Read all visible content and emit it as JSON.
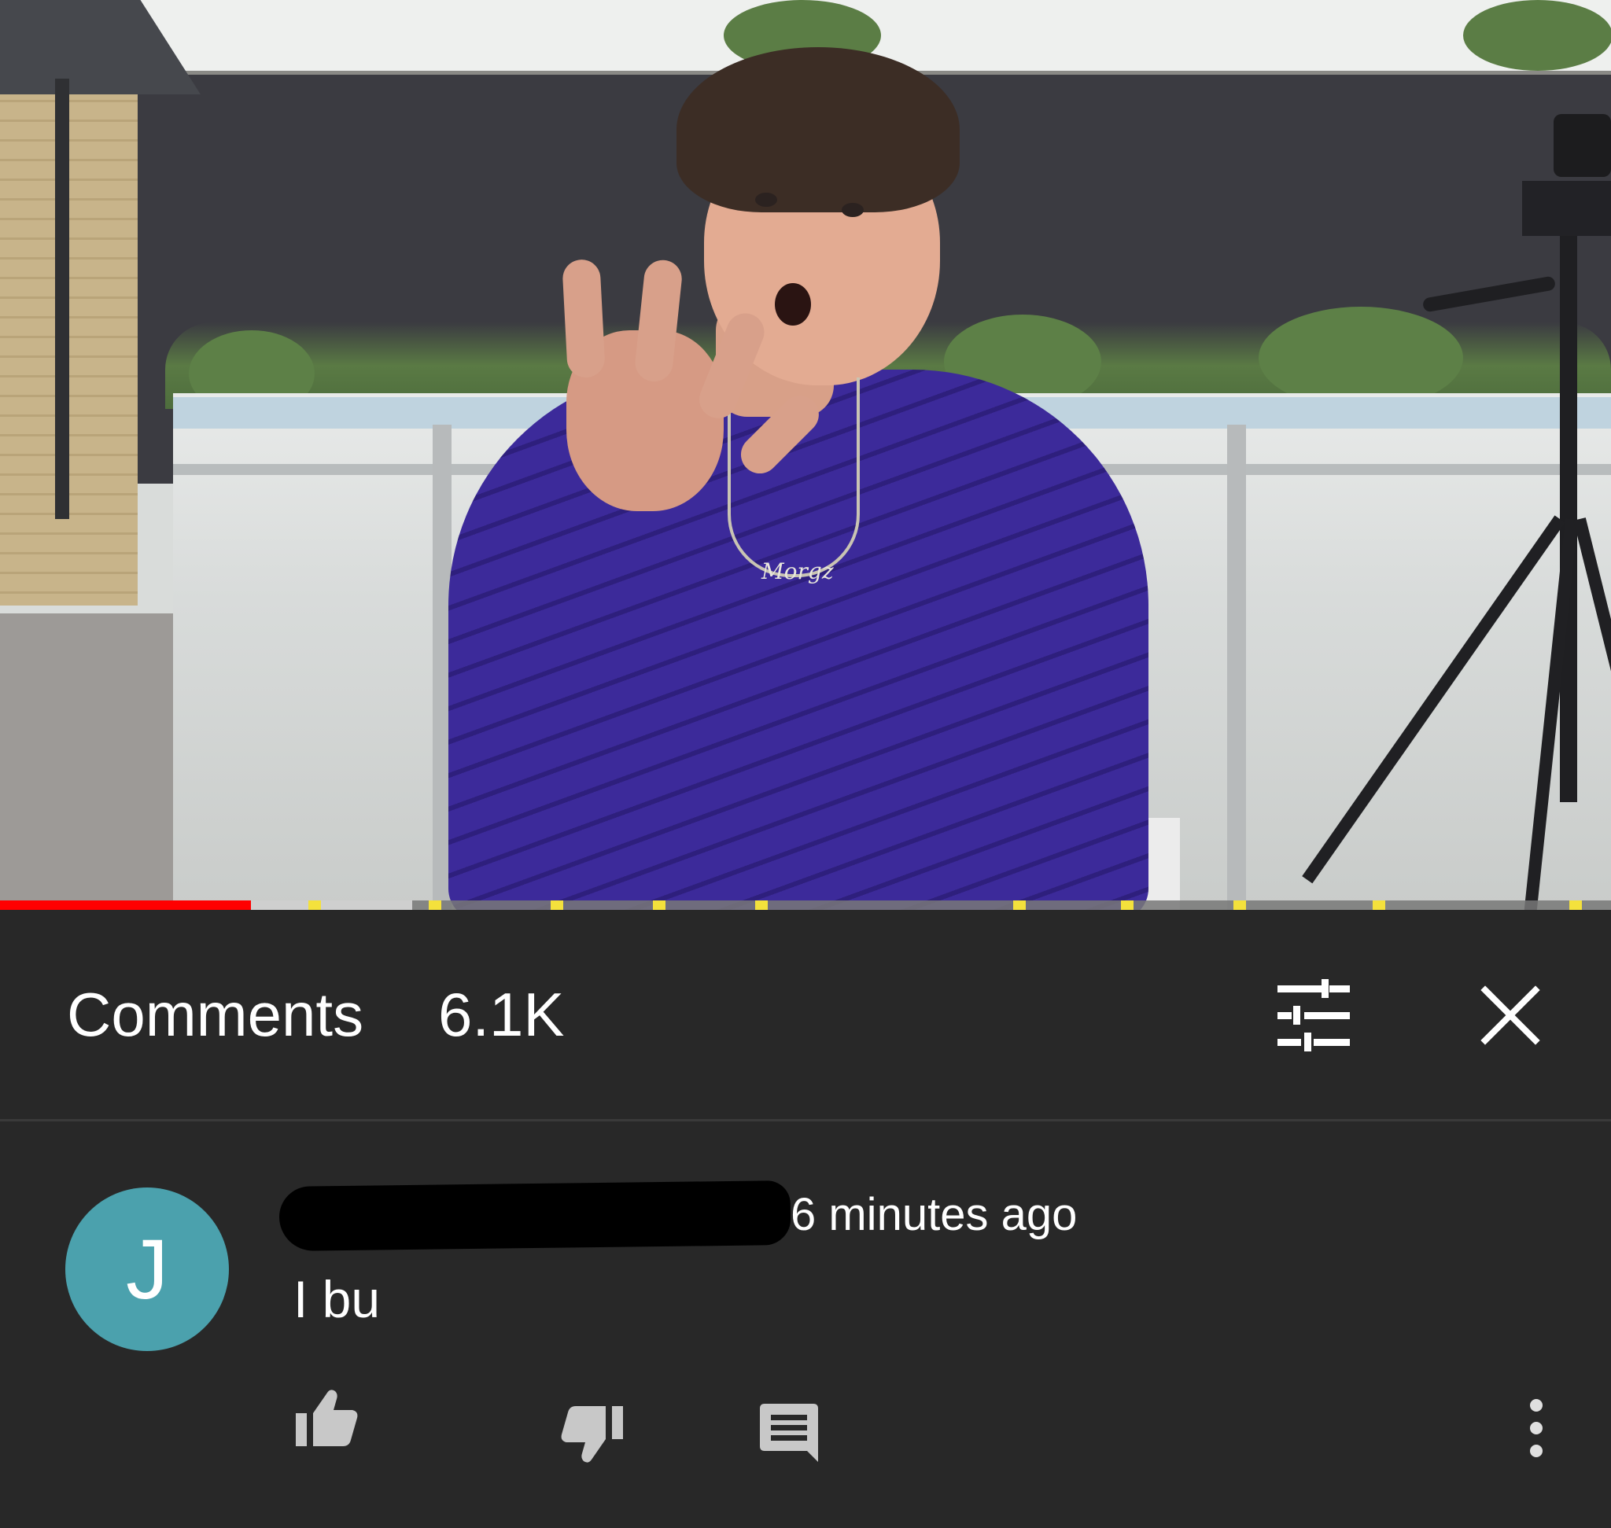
{
  "video": {
    "progress_played": 0.156,
    "progress_buffered": 0.256,
    "pendant_text": "Morgz"
  },
  "comments_panel": {
    "title": "Comments",
    "count": "6.1K",
    "sort_icon": "tune-icon",
    "close_icon": "close-icon"
  },
  "comment": {
    "avatar_letter": "J",
    "author": "",
    "timestamp": "6 minutes ago",
    "text": "I bu",
    "actions": {
      "like_icon": "thumb-up-icon",
      "dislike_icon": "thumb-down-icon",
      "reply_icon": "reply-icon",
      "more_icon": "more-vert-icon"
    }
  },
  "colors": {
    "background": "#282828",
    "avatar": "#4ba1ad",
    "progress_played": "#ff0000",
    "chapter_marker": "#f4e13c"
  }
}
